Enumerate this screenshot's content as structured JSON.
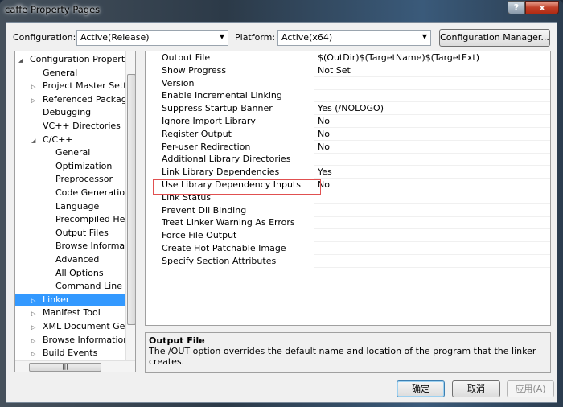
{
  "window": {
    "title": "caffe Property Pages",
    "help": "?",
    "close": "x"
  },
  "toolbar": {
    "configuration_label": "Configuration:",
    "configuration_value": "Active(Release)",
    "platform_label": "Platform:",
    "platform_value": "Active(x64)",
    "config_manager": "Configuration Manager..."
  },
  "tree": [
    {
      "label": "Configuration Properties",
      "level": 0,
      "expander": "open"
    },
    {
      "label": "General",
      "level": 1,
      "expander": "none"
    },
    {
      "label": "Project Master Settin",
      "level": 1,
      "expander": "closed"
    },
    {
      "label": "Referenced Packages",
      "level": 1,
      "expander": "closed"
    },
    {
      "label": "Debugging",
      "level": 1,
      "expander": "none"
    },
    {
      "label": "VC++ Directories",
      "level": 1,
      "expander": "none"
    },
    {
      "label": "C/C++",
      "level": 1,
      "expander": "open"
    },
    {
      "label": "General",
      "level": 2,
      "expander": "none"
    },
    {
      "label": "Optimization",
      "level": 2,
      "expander": "none"
    },
    {
      "label": "Preprocessor",
      "level": 2,
      "expander": "none"
    },
    {
      "label": "Code Generation",
      "level": 2,
      "expander": "none"
    },
    {
      "label": "Language",
      "level": 2,
      "expander": "none"
    },
    {
      "label": "Precompiled Head",
      "level": 2,
      "expander": "none"
    },
    {
      "label": "Output Files",
      "level": 2,
      "expander": "none"
    },
    {
      "label": "Browse Informatio",
      "level": 2,
      "expander": "none"
    },
    {
      "label": "Advanced",
      "level": 2,
      "expander": "none"
    },
    {
      "label": "All Options",
      "level": 2,
      "expander": "none"
    },
    {
      "label": "Command Line",
      "level": 2,
      "expander": "none"
    },
    {
      "label": "Linker",
      "level": 1,
      "expander": "closed",
      "selected": true
    },
    {
      "label": "Manifest Tool",
      "level": 1,
      "expander": "closed"
    },
    {
      "label": "XML Document Gene",
      "level": 1,
      "expander": "closed"
    },
    {
      "label": "Browse Information",
      "level": 1,
      "expander": "closed"
    },
    {
      "label": "Build Events",
      "level": 1,
      "expander": "closed"
    }
  ],
  "properties": [
    {
      "name": "Output File",
      "value": "$(OutDir)$(TargetName)$(TargetExt)"
    },
    {
      "name": "Show Progress",
      "value": "Not Set"
    },
    {
      "name": "Version",
      "value": ""
    },
    {
      "name": "Enable Incremental Linking",
      "value": ""
    },
    {
      "name": "Suppress Startup Banner",
      "value": "Yes (/NOLOGO)"
    },
    {
      "name": "Ignore Import Library",
      "value": "No"
    },
    {
      "name": "Register Output",
      "value": "No"
    },
    {
      "name": "Per-user Redirection",
      "value": "No"
    },
    {
      "name": "Additional Library Directories",
      "value": "",
      "highlighted": true
    },
    {
      "name": "Link Library Dependencies",
      "value": "Yes"
    },
    {
      "name": "Use Library Dependency Inputs",
      "value": "No"
    },
    {
      "name": "Link Status",
      "value": ""
    },
    {
      "name": "Prevent Dll Binding",
      "value": ""
    },
    {
      "name": "Treat Linker Warning As Errors",
      "value": ""
    },
    {
      "name": "Force File Output",
      "value": ""
    },
    {
      "name": "Create Hot Patchable Image",
      "value": ""
    },
    {
      "name": "Specify Section Attributes",
      "value": ""
    }
  ],
  "description": {
    "title": "Output File",
    "text": "The /OUT option overrides the default name and location of the program that the linker creates."
  },
  "buttons": {
    "ok": "确定",
    "cancel": "取消",
    "apply": "应用(A)"
  },
  "colors": {
    "selection": "#3399ff",
    "highlight_box": "#e05050"
  }
}
